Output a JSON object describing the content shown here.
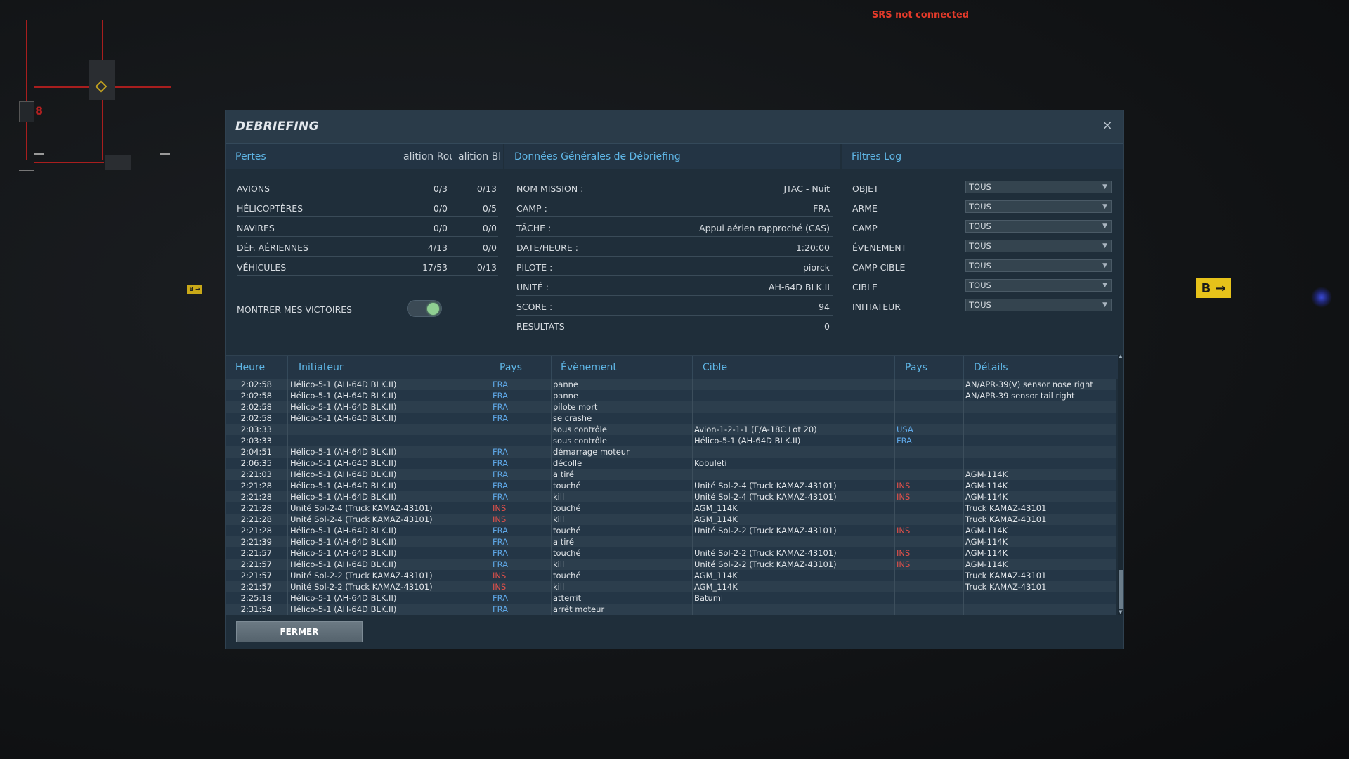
{
  "srs_status": "SRS not connected",
  "dialog": {
    "title": "DEBRIEFING",
    "close_glyph": "×",
    "close_button_label": "FERMER"
  },
  "losses": {
    "title": "Pertes",
    "col_red": "alition Rou",
    "col_blue": "alition Bl",
    "rows": [
      {
        "label": "AVIONS",
        "red": "0/3",
        "blue": "0/13"
      },
      {
        "label": "HÉLICOPTÈRES",
        "red": "0/0",
        "blue": "0/5"
      },
      {
        "label": "NAVIRES",
        "red": "0/0",
        "blue": "0/0"
      },
      {
        "label": "DÉF. AÉRIENNES",
        "red": "4/13",
        "blue": "0/0"
      },
      {
        "label": "VÉHICULES",
        "red": "17/53",
        "blue": "0/13"
      }
    ],
    "show_victories_label": "MONTRER MES VICTOIRES",
    "show_victories_on": true
  },
  "general": {
    "title": "Données Générales de Débriefing",
    "rows": [
      {
        "label": "NOM MISSION :",
        "value": "JTAC - Nuit"
      },
      {
        "label": "CAMP :",
        "value": "FRA"
      },
      {
        "label": "TÂCHE :",
        "value": "Appui aérien rapproché (CAS)"
      },
      {
        "label": "DATE/HEURE :",
        "value": "1:20:00"
      },
      {
        "label": "PILOTE :",
        "value": "piorck"
      },
      {
        "label": "UNITÉ :",
        "value": "AH-64D BLK.II"
      },
      {
        "label": "SCORE :",
        "value": "94"
      },
      {
        "label": "RESULTATS",
        "value": "0"
      }
    ]
  },
  "filters": {
    "title": "Filtres Log",
    "rows": [
      {
        "label": "OBJET",
        "value": "TOUS"
      },
      {
        "label": "ARME",
        "value": "TOUS"
      },
      {
        "label": "CAMP",
        "value": "TOUS"
      },
      {
        "label": "ÉVENEMENT",
        "value": "TOUS"
      },
      {
        "label": "CAMP CIBLE",
        "value": "TOUS"
      },
      {
        "label": "CIBLE",
        "value": "TOUS"
      },
      {
        "label": "INITIATEUR",
        "value": "TOUS"
      }
    ]
  },
  "log": {
    "headers": [
      "Heure",
      "Initiateur",
      "Pays",
      "Évènement",
      "Cible",
      "Pays",
      "Détails"
    ],
    "rows": [
      {
        "time": "2:02:58",
        "initiator": "Hélico-5-1 (AH-64D BLK.II)",
        "country": "FRA",
        "event": "panne",
        "target": "",
        "tcountry": "",
        "details": "AN/APR-39(V) sensor nose right"
      },
      {
        "time": "2:02:58",
        "initiator": "Hélico-5-1 (AH-64D BLK.II)",
        "country": "FRA",
        "event": "panne",
        "target": "",
        "tcountry": "",
        "details": "AN/APR-39 sensor tail right"
      },
      {
        "time": "2:02:58",
        "initiator": "Hélico-5-1 (AH-64D BLK.II)",
        "country": "FRA",
        "event": "pilote mort",
        "target": "",
        "tcountry": "",
        "details": ""
      },
      {
        "time": "2:02:58",
        "initiator": "Hélico-5-1 (AH-64D BLK.II)",
        "country": "FRA",
        "event": "se crashe",
        "target": "",
        "tcountry": "",
        "details": ""
      },
      {
        "time": "2:03:33",
        "initiator": "",
        "country": "",
        "event": "sous contrôle",
        "target": "Avion-1-2-1-1 (F/A-18C Lot 20)",
        "tcountry": "USA",
        "details": ""
      },
      {
        "time": "2:03:33",
        "initiator": "",
        "country": "",
        "event": "sous contrôle",
        "target": "Hélico-5-1 (AH-64D BLK.II)",
        "tcountry": "FRA",
        "details": ""
      },
      {
        "time": "2:04:51",
        "initiator": "Hélico-5-1 (AH-64D BLK.II)",
        "country": "FRA",
        "event": "démarrage moteur",
        "target": "",
        "tcountry": "",
        "details": ""
      },
      {
        "time": "2:06:35",
        "initiator": "Hélico-5-1 (AH-64D BLK.II)",
        "country": "FRA",
        "event": "décolle",
        "target": "Kobuleti",
        "tcountry": "",
        "details": ""
      },
      {
        "time": "2:21:03",
        "initiator": "Hélico-5-1 (AH-64D BLK.II)",
        "country": "FRA",
        "event": "a tiré",
        "target": "",
        "tcountry": "",
        "details": "AGM-114K"
      },
      {
        "time": "2:21:28",
        "initiator": "Hélico-5-1 (AH-64D BLK.II)",
        "country": "FRA",
        "event": "touché",
        "target": "Unité Sol-2-4 (Truck KAMAZ-43101)",
        "tcountry": "INS",
        "details": "AGM-114K"
      },
      {
        "time": "2:21:28",
        "initiator": "Hélico-5-1 (AH-64D BLK.II)",
        "country": "FRA",
        "event": "kill",
        "target": "Unité Sol-2-4 (Truck KAMAZ-43101)",
        "tcountry": "INS",
        "details": "AGM-114K"
      },
      {
        "time": "2:21:28",
        "initiator": "Unité Sol-2-4 (Truck KAMAZ-43101)",
        "country": "INS",
        "event": "touché",
        "target": "AGM_114K",
        "tcountry": "",
        "details": "Truck KAMAZ-43101"
      },
      {
        "time": "2:21:28",
        "initiator": "Unité Sol-2-4 (Truck KAMAZ-43101)",
        "country": "INS",
        "event": "kill",
        "target": "AGM_114K",
        "tcountry": "",
        "details": "Truck KAMAZ-43101"
      },
      {
        "time": "2:21:28",
        "initiator": "Hélico-5-1 (AH-64D BLK.II)",
        "country": "FRA",
        "event": "touché",
        "target": "Unité Sol-2-2 (Truck KAMAZ-43101)",
        "tcountry": "INS",
        "details": "AGM-114K"
      },
      {
        "time": "2:21:39",
        "initiator": "Hélico-5-1 (AH-64D BLK.II)",
        "country": "FRA",
        "event": "a tiré",
        "target": "",
        "tcountry": "",
        "details": "AGM-114K"
      },
      {
        "time": "2:21:57",
        "initiator": "Hélico-5-1 (AH-64D BLK.II)",
        "country": "FRA",
        "event": "touché",
        "target": "Unité Sol-2-2 (Truck KAMAZ-43101)",
        "tcountry": "INS",
        "details": "AGM-114K"
      },
      {
        "time": "2:21:57",
        "initiator": "Hélico-5-1 (AH-64D BLK.II)",
        "country": "FRA",
        "event": "kill",
        "target": "Unité Sol-2-2 (Truck KAMAZ-43101)",
        "tcountry": "INS",
        "details": "AGM-114K"
      },
      {
        "time": "2:21:57",
        "initiator": "Unité Sol-2-2 (Truck KAMAZ-43101)",
        "country": "INS",
        "event": "touché",
        "target": "AGM_114K",
        "tcountry": "",
        "details": "Truck KAMAZ-43101"
      },
      {
        "time": "2:21:57",
        "initiator": "Unité Sol-2-2 (Truck KAMAZ-43101)",
        "country": "INS",
        "event": "kill",
        "target": "AGM_114K",
        "tcountry": "",
        "details": "Truck KAMAZ-43101"
      },
      {
        "time": "2:25:18",
        "initiator": "Hélico-5-1 (AH-64D BLK.II)",
        "country": "FRA",
        "event": "atterrit",
        "target": "Batumi",
        "tcountry": "",
        "details": ""
      },
      {
        "time": "2:31:54",
        "initiator": "Hélico-5-1 (AH-64D BLK.II)",
        "country": "FRA",
        "event": "arrêt moteur",
        "target": "",
        "tcountry": "",
        "details": ""
      }
    ]
  },
  "background": {
    "sign_letter": "B",
    "sign_arrow": "→",
    "small_sign": "B →",
    "hud_letter": "8"
  },
  "colors": {
    "accent_blue": "#5fb6e6",
    "country_friendly": "#5fa8e8",
    "country_enemy": "#e0504a",
    "srs_red": "#e23a2a"
  }
}
